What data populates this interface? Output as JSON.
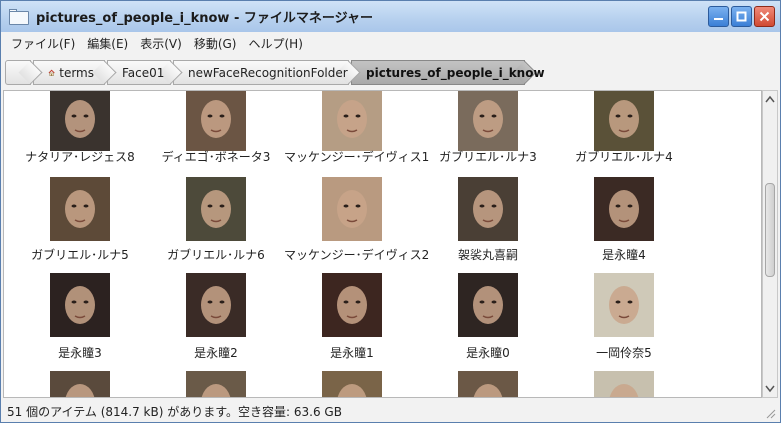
{
  "window": {
    "title": "pictures_of_people_i_know - ファイルマネージャー"
  },
  "menu": [
    "ファイル(F)",
    "編集(E)",
    "表示(V)",
    "移動(G)",
    "ヘルプ(H)"
  ],
  "path": [
    "terms",
    "Face01",
    "newFaceRecognitionFolder",
    "pictures_of_people_i_know"
  ],
  "items": [
    {
      "label": "ナタリア･レジェス8",
      "tone": "#3a332e"
    },
    {
      "label": "ディエゴ･ボネータ3",
      "tone": "#6b5544"
    },
    {
      "label": "マッケンジー･デイヴィス1",
      "tone": "#b59d84"
    },
    {
      "label": "ガブリエル･ルナ3",
      "tone": "#7a6b5c"
    },
    {
      "label": "ガブリエル･ルナ4",
      "tone": "#5a5138"
    },
    {
      "label": "ガブリエル･ルナ5",
      "tone": "#5d4a38"
    },
    {
      "label": "ガブリエル･ルナ6",
      "tone": "#4d4a3a"
    },
    {
      "label": "マッケンジー･デイヴィス2",
      "tone": "#b99a80"
    },
    {
      "label": "袈裟丸喜嗣",
      "tone": "#4a3f35"
    },
    {
      "label": "是永瞳4",
      "tone": "#3b2a24"
    },
    {
      "label": "是永瞳3",
      "tone": "#2c2220"
    },
    {
      "label": "是永瞳2",
      "tone": "#3a2b26"
    },
    {
      "label": "是永瞳1",
      "tone": "#3d2620"
    },
    {
      "label": "是永瞳0",
      "tone": "#2e2522"
    },
    {
      "label": "一岡伶奈5",
      "tone": "#cfc9b8"
    },
    {
      "label": "",
      "tone": "#5a4a3c"
    },
    {
      "label": "",
      "tone": "#6a5a48"
    },
    {
      "label": "",
      "tone": "#7a6448"
    },
    {
      "label": "",
      "tone": "#6b5846"
    },
    {
      "label": "",
      "tone": "#c7c0ae"
    }
  ],
  "status": {
    "text": "51 個のアイテム (814.7 kB) があります。空き容量: 63.6 GB"
  }
}
